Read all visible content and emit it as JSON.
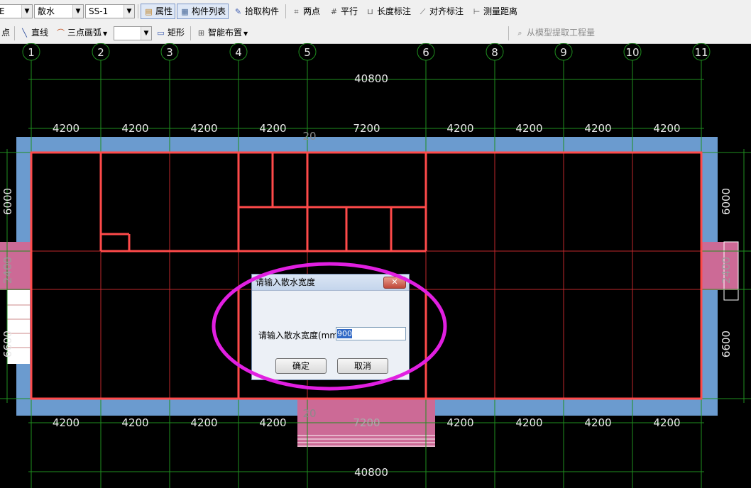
{
  "toolbar1": {
    "combo0_value": "E",
    "combo1_value": "散水",
    "combo2_value": "SS-1",
    "property_label": "属性",
    "component_list_label": "构件列表",
    "pick_component_label": "拾取构件",
    "two_point_label": "两点",
    "parallel_label": "平行",
    "length_dim_label": "长度标注",
    "align_dim_label": "对齐标注",
    "measure_label": "测量距离"
  },
  "toolbar2": {
    "point_label": "点",
    "line_label": "直线",
    "arc_label": "三点画弧",
    "arc_combo_value": "",
    "rect_label": "矩形",
    "smart_layout_label": "智能布置",
    "extract_label": "从模型提取工程量"
  },
  "axes": {
    "top_labels": [
      "1",
      "2",
      "3",
      "4",
      "5",
      "6",
      "8",
      "9",
      "10",
      "11"
    ],
    "total_top": "40800",
    "total_bottom": "40800",
    "top_dims": [
      "4200",
      "4200",
      "4200",
      "4200",
      "7200",
      "4200",
      "4200",
      "4200",
      "4200"
    ],
    "bottom_dims": [
      "4200",
      "4200",
      "4200",
      "4200",
      "7200",
      "4200",
      "4200",
      "4200",
      "4200"
    ],
    "left_dims": [
      "6000",
      "2400",
      "6600"
    ],
    "right_dims": [
      "6000",
      "2400",
      "6600"
    ],
    "small_top": "20",
    "small_bottom": "20"
  },
  "dialog": {
    "title": "请输入散水宽度",
    "prompt": "请输入散水宽度(mm)",
    "value": "900",
    "ok_label": "确定",
    "cancel_label": "取消",
    "close_glyph": "✕"
  },
  "colors": {
    "background": "#000000",
    "grid": "#1f8f1f",
    "axis_red": "#c0282c",
    "wall": "#ff4a4a",
    "apron": "#6b9bcf",
    "pink": "#cc6a96",
    "highlight": "#e11fe1"
  }
}
